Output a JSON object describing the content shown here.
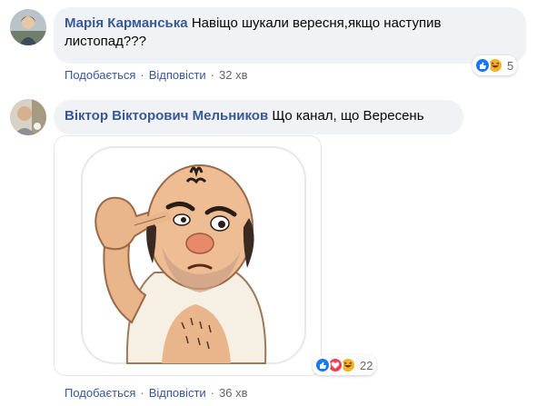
{
  "comments": [
    {
      "author": "Марія Карманська",
      "text": "Навіщо шукали вересня,якщо наступив листопад???",
      "actions": {
        "like": "Подобається",
        "reply": "Відповісти",
        "time": "32 хв"
      },
      "reactions": {
        "icons": [
          "like-icon",
          "haha-icon"
        ],
        "count": "5"
      }
    },
    {
      "author": "Віктор Вікторович Мельников",
      "text": "Що канал, що Вересень",
      "actions": {
        "like": "Подобається",
        "reply": "Відповісти",
        "time": "36 хв"
      },
      "reactions": {
        "icons": [
          "like-icon",
          "love-icon",
          "haha-icon"
        ],
        "count": "22"
      },
      "attachment": "sticker"
    }
  ],
  "colors": {
    "author": "#385898",
    "bubble": "#f0f2f5",
    "meta": "#65676b",
    "like": "#1877f2",
    "love": "#f33e58",
    "haha": "#f7b125"
  },
  "separator": "·"
}
